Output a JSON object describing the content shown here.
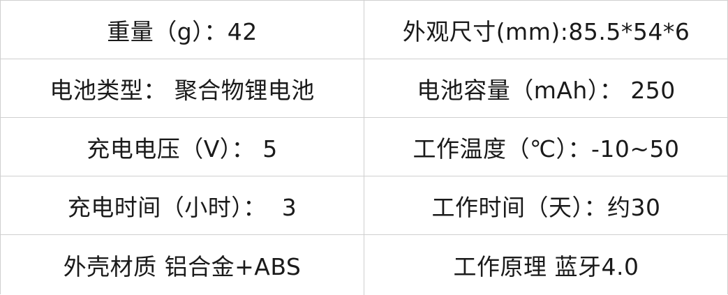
{
  "rows": [
    {
      "left": "重量（g）：42",
      "right": "外观尺寸(mm):85.5*54*6"
    },
    {
      "left": "电池类型： 聚合物锂电池",
      "right": "电池容量（mAh）： 250"
    },
    {
      "left": "充电电压（V）： 5",
      "right": "工作温度（℃）：-10~50"
    },
    {
      "left": "充电时间（小时）：  3",
      "right": "工作时间（天）：约30"
    },
    {
      "left": "外壳材质 铝合金+ABS",
      "right": "工作原理 蓝牙4.0"
    }
  ]
}
